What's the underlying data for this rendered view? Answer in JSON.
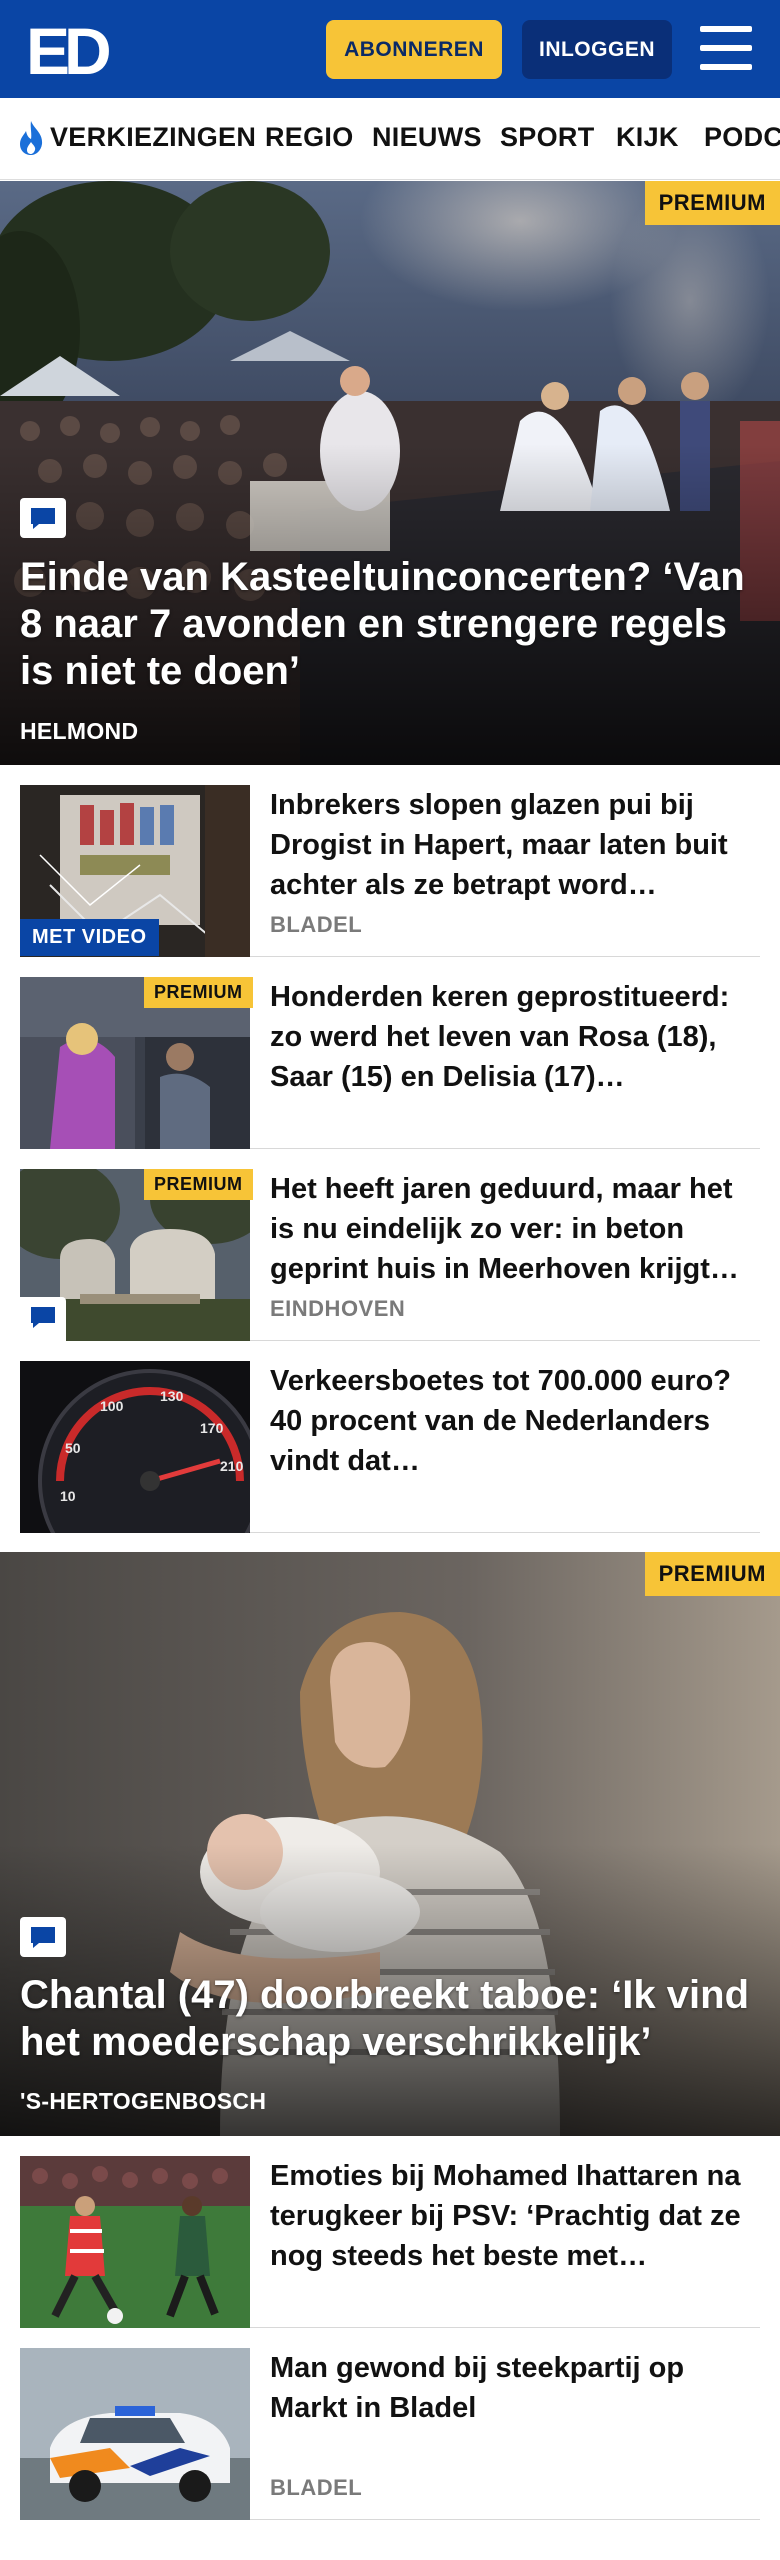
{
  "header": {
    "logo_text": "ED",
    "subscribe_label": "ABONNEREN",
    "login_label": "INLOGGEN"
  },
  "nav": {
    "items": [
      "VERKIEZINGEN",
      "REGIO",
      "NIEUWS",
      "SPORT",
      "KIJK",
      "PODC"
    ]
  },
  "hero1": {
    "badge": "PREMIUM",
    "title": "Einde van Kasteeltuinconcerten? ‘Van 8 naar 7 avonden en strengere regels is niet te doen’",
    "location": "HELMOND"
  },
  "articles": [
    {
      "title": "Inbrekers slopen glazen pui bij Drogist in Hapert, maar laten buit achter als ze betrapt word…",
      "location": "BLADEL",
      "tag": "MET VIDEO",
      "premium": ""
    },
    {
      "title": "Honderden keren geprostitueerd: zo werd het leven van Rosa (18), Saar (15) en Delisia (17)…",
      "location": "",
      "tag": "",
      "premium": "PREMIUM"
    },
    {
      "title": "Het heeft jaren geduurd, maar het is nu eindelijk zo ver: in beton geprint huis in Meerhoven krijgt…",
      "location": "EINDHOVEN",
      "tag": "",
      "premium": "PREMIUM"
    },
    {
      "title": "Verkeersboetes tot 700.000 euro? 40 procent van de Nederlanders vindt dat…",
      "location": "",
      "tag": "",
      "premium": ""
    }
  ],
  "hero2": {
    "badge": "PREMIUM",
    "title": "Chantal (47) doorbreekt taboe: ‘Ik vind het moederschap verschrikkelijk’",
    "location": "'S-HERTOGENBOSCH"
  },
  "articles2": [
    {
      "title": "Emoties bij Mohamed Ihattaren na terugkeer bij PSV: ‘Prachtig dat ze nog steeds het beste met…",
      "location": ""
    },
    {
      "title": "Man gewond bij steekpartij op Markt in Bladel",
      "location": "BLADEL"
    }
  ],
  "colors": {
    "brand_blue": "#0a45a5",
    "premium_yellow": "#f7c437",
    "login_blue": "#0a2f78"
  }
}
